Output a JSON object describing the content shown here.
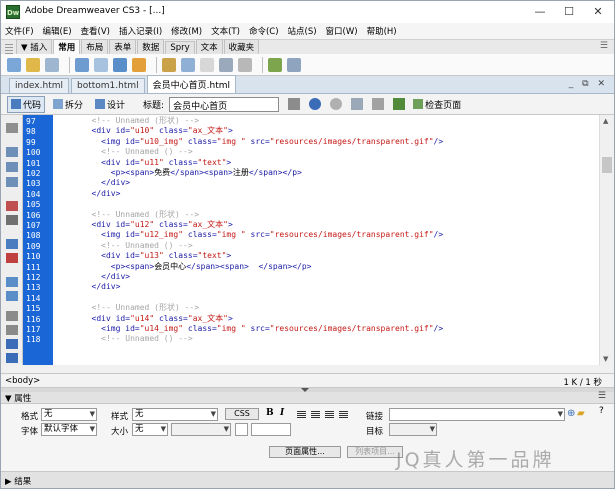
{
  "window": {
    "title": "Adobe Dreamweaver CS3 - [...]",
    "minimize": "—",
    "maximize": "☐",
    "close": "✕",
    "app_icon": "Dw"
  },
  "menu": [
    "文件(F)",
    "编辑(E)",
    "查看(V)",
    "插入记录(I)",
    "修改(M)",
    "文本(T)",
    "命令(C)",
    "站点(S)",
    "窗口(W)",
    "帮助(H)"
  ],
  "insert_bar": {
    "tabs": [
      "▼ 插入",
      "常用",
      "布局",
      "表单",
      "数据",
      "Spry",
      "文本",
      "收藏夹"
    ],
    "active": 1
  },
  "doc_tabs": {
    "tabs": [
      "index.html",
      "bottom1.html",
      "会员中心首页.html"
    ],
    "active": 2,
    "window_controls": "_ ⧉ ✕"
  },
  "doc_toolbar": {
    "code": "代码",
    "split": "拆分",
    "design": "设计",
    "title_label": "标题:",
    "title_value": "会员中心首页",
    "check_page": "检查页面"
  },
  "code_lines": [
    {
      "n": "97",
      "t": "        <!-- Unnamed (形状) -->"
    },
    {
      "n": "98",
      "t": "        <div id=\"u10\" class=\"ax_文本\">"
    },
    {
      "n": "99",
      "t": "          <img id=\"u10_img\" class=\"img \" src=\"resources/images/transparent.gif\"/>"
    },
    {
      "n": "100",
      "t": "          <!-- Unnamed () -->"
    },
    {
      "n": "101",
      "t": "          <div id=\"u11\" class=\"text\">"
    },
    {
      "n": "102",
      "t": "            <p><span>免费</span><span>注册</span></p>"
    },
    {
      "n": "103",
      "t": "          </div>"
    },
    {
      "n": "104",
      "t": "        </div>"
    },
    {
      "n": "105",
      "t": ""
    },
    {
      "n": "106",
      "t": "        <!-- Unnamed (形状) -->"
    },
    {
      "n": "107",
      "t": "        <div id=\"u12\" class=\"ax_文本\">"
    },
    {
      "n": "108",
      "t": "          <img id=\"u12_img\" class=\"img \" src=\"resources/images/transparent.gif\"/>"
    },
    {
      "n": "109",
      "t": "          <!-- Unnamed () -->"
    },
    {
      "n": "110",
      "t": "          <div id=\"u13\" class=\"text\">"
    },
    {
      "n": "111",
      "t": "            <p><span>会员中心</span><span>  </span></p>"
    },
    {
      "n": "112",
      "t": "          </div>"
    },
    {
      "n": "113",
      "t": "        </div>"
    },
    {
      "n": "114",
      "t": ""
    },
    {
      "n": "115",
      "t": "        <!-- Unnamed (形状) -->"
    },
    {
      "n": "116",
      "t": "        <div id=\"u14\" class=\"ax_文本\">"
    },
    {
      "n": "117",
      "t": "          <img id=\"u14_img\" class=\"img \" src=\"resources/images/transparent.gif\"/>"
    },
    {
      "n": "118",
      "t": "          <!-- Unnamed () -->"
    }
  ],
  "status": {
    "tag": "<body>",
    "info": "1 K / 1 秒"
  },
  "properties": {
    "header": "▼ 属性",
    "format_label": "格式",
    "format_value": "无",
    "style_label": "样式",
    "style_value": "无",
    "css_button": "CSS",
    "bold": "B",
    "italic": "I",
    "font_label": "字体",
    "font_value": "默认字体",
    "size_label": "大小",
    "size_value": "无",
    "link_label": "链接",
    "target_label": "目标",
    "page_props_button": "页面属性...",
    "list_item_button": "列表项目..."
  },
  "results": {
    "label": "▶ 结果"
  },
  "watermark": "JQ真人第一品牌"
}
